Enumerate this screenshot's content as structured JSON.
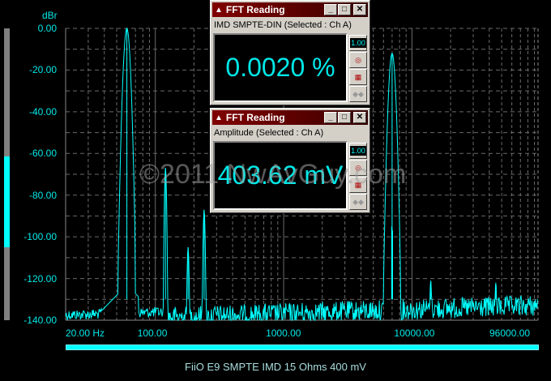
{
  "chart_data": {
    "type": "line",
    "title": "FiiO E9 SMPTE IMD 15 Ohms 400 mV",
    "ylabel": "dBr",
    "xlabel": "",
    "xscale": "log",
    "xlim": [
      20,
      96000
    ],
    "ylim": [
      -140,
      0
    ],
    "yticks": [
      "0.00",
      "-20.00",
      "-40.00",
      "-60.00",
      "-80.00",
      "-100.00",
      "-120.00",
      "-140.00"
    ],
    "xticks": [
      {
        "value": 20,
        "label": "20.00 Hz"
      },
      {
        "value": 100,
        "label": "100.00"
      },
      {
        "value": 1000,
        "label": "1000.00"
      },
      {
        "value": 10000,
        "label": "10000.00"
      },
      {
        "value": 96000,
        "label": "96000.00"
      }
    ],
    "grid": true,
    "color": "#00ffff",
    "noise_floor_db": [
      -135,
      -128
    ],
    "peaks": [
      {
        "freq": 60,
        "level": 0
      },
      {
        "freq": 120,
        "level": -67
      },
      {
        "freq": 180,
        "level": -105
      },
      {
        "freq": 240,
        "level": -87
      },
      {
        "freq": 7000,
        "level": -12
      },
      {
        "freq": 6940,
        "level": -95
      },
      {
        "freq": 7060,
        "level": -97
      },
      {
        "freq": 14000,
        "level": -121
      },
      {
        "freq": 45000,
        "level": -122
      }
    ]
  },
  "level_meter": {
    "fraction_low": 0.25,
    "fraction_high": 0.56
  },
  "watermark": "©2011 NwAvGuy.com",
  "windows": [
    {
      "title": "FFT Reading",
      "label": "IMD SMPTE-DIN (Selected : Ch A)",
      "value": "0.0020 %"
    },
    {
      "title": "FFT Reading",
      "label": "Amplitude (Selected : Ch A)",
      "value": "403.62 mV"
    }
  ],
  "buttons": {
    "min": "_",
    "max": "□",
    "close": "✕",
    "format": "1.00"
  }
}
